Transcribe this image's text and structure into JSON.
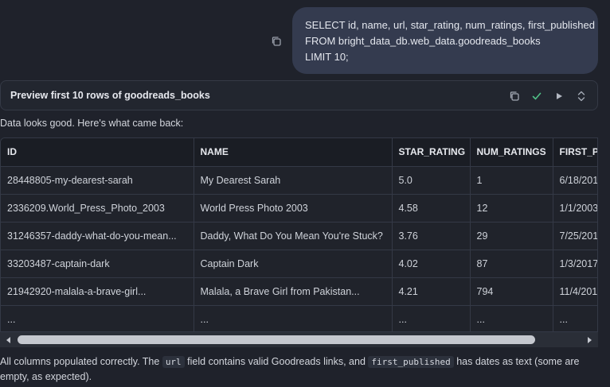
{
  "user_message": {
    "lines": [
      "SELECT id, name, url, star_rating, num_ratings, first_published",
      "FROM bright_data_db.web_data.goodreads_books",
      "LIMIT 10;"
    ]
  },
  "query_panel": {
    "title": "Preview first 10 rows of goodreads_books"
  },
  "response": {
    "intro": "Data looks good. Here's what came back:",
    "summary_part1": "All columns populated correctly. The ",
    "summary_code1": "url",
    "summary_part2": " field contains valid Goodreads links, and ",
    "summary_code2": "first_published",
    "summary_part3": " has dates as text (some are empty, as expected)."
  },
  "table": {
    "columns": [
      "ID",
      "NAME",
      "STAR_RATING",
      "NUM_RATINGS",
      "FIRST_PU"
    ],
    "rows": [
      [
        "28448805-my-dearest-sarah",
        "My Dearest Sarah",
        "5.0",
        "1",
        "6/18/201"
      ],
      [
        "2336209.World_Press_Photo_2003",
        "World Press Photo 2003",
        "4.58",
        "12",
        "1/1/2003"
      ],
      [
        "31246357-daddy-what-do-you-mean...",
        "Daddy, What Do You Mean You're Stuck?",
        "3.76",
        "29",
        "7/25/201"
      ],
      [
        "33203487-captain-dark",
        "Captain Dark",
        "4.02",
        "87",
        "1/3/2017"
      ],
      [
        "21942920-malala-a-brave-girl...",
        "Malala, a Brave Girl from Pakistan...",
        "4.21",
        "794",
        "11/4/201"
      ],
      [
        "...",
        "...",
        "...",
        "...",
        "..."
      ]
    ]
  },
  "icons": {
    "copy": "copy-icon",
    "check": "check-icon",
    "run": "play-icon",
    "expand": "chevron-updown-icon"
  },
  "colors": {
    "background": "#1f222b",
    "bubble": "#343b4f",
    "check": "#4fbf86"
  }
}
